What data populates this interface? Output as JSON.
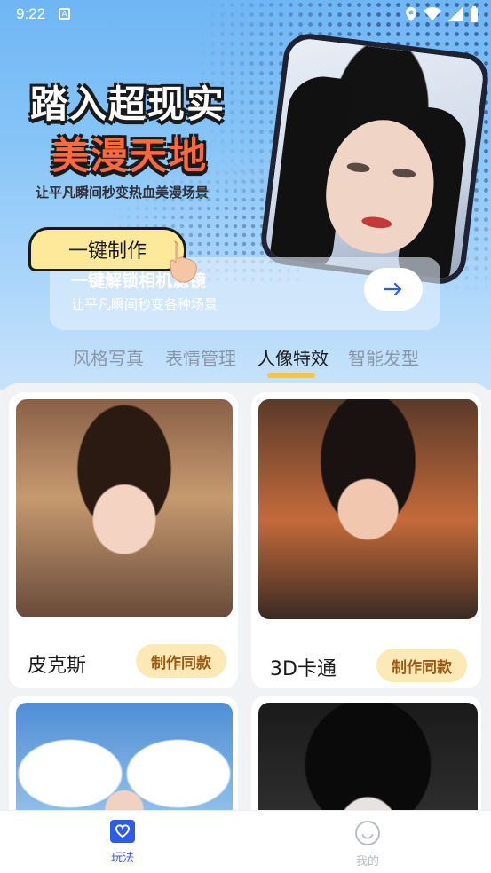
{
  "status_bar": {
    "time": "9:22",
    "notification_icon": "A"
  },
  "hero": {
    "title_line1": "踏入超现实",
    "title_line2": "美漫天地",
    "subtitle": "让平凡瞬间秒变热血美漫场景",
    "cta_label": "一键制作"
  },
  "banner": {
    "title": "一键解锁相机滤镜",
    "subtitle": "让平凡瞬间秒变各种场景",
    "arrow_icon": "arrow-right-icon"
  },
  "tabs": [
    {
      "label": "风格写真",
      "active": false
    },
    {
      "label": "表情管理",
      "active": false
    },
    {
      "label": "人像特效",
      "active": true
    },
    {
      "label": "智能发型",
      "active": false
    }
  ],
  "cards": [
    {
      "name": "皮克斯",
      "button": "制作同款"
    },
    {
      "name": "3D卡通",
      "button": "制作同款"
    },
    {
      "name": "",
      "button": ""
    },
    {
      "name": "",
      "button": ""
    }
  ],
  "bottom_nav": [
    {
      "label": "玩法",
      "icon": "heart-icon",
      "active": true
    },
    {
      "label": "我的",
      "icon": "smile-icon",
      "active": false
    }
  ],
  "colors": {
    "accent": "#2f5bea",
    "button_bg": "#fde9b6",
    "button_text": "#9a5a15",
    "tab_underline": "#f6c544"
  }
}
